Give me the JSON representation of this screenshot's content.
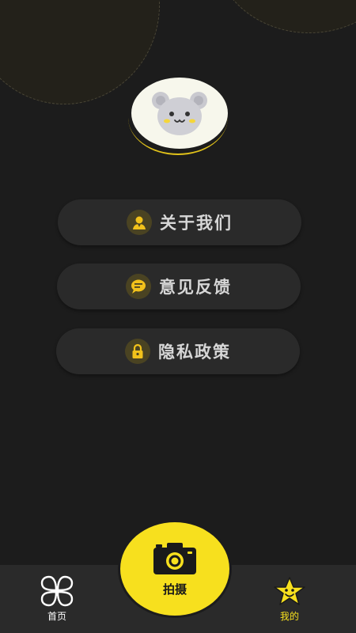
{
  "menu": {
    "items": [
      {
        "label": "关于我们",
        "icon": "person-icon"
      },
      {
        "label": "意见反馈",
        "icon": "message-icon"
      },
      {
        "label": "隐私政策",
        "icon": "lock-icon"
      }
    ]
  },
  "tabbar": {
    "home_label": "首页",
    "capture_label": "拍摄",
    "mine_label": "我的"
  },
  "colors": {
    "accent": "#f7e01e",
    "background": "#1c1c1c",
    "button": "#2a2a2a"
  }
}
